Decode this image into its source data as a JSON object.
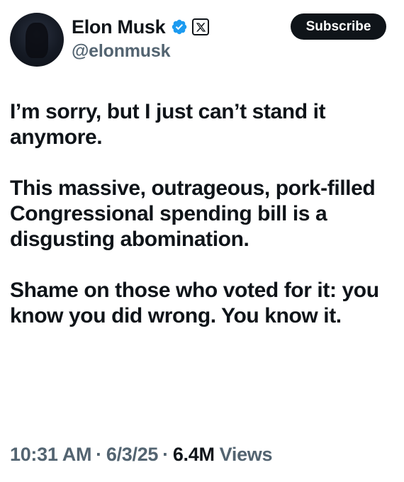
{
  "author": {
    "name": "Elon Musk",
    "handle": "@elonmusk",
    "verified_icon": "verified-badge-icon",
    "affiliate_icon": "x-logo-icon"
  },
  "actions": {
    "subscribe_label": "Subscribe"
  },
  "tweet": {
    "paragraphs": [
      "I’m sorry, but I just can’t stand it anymore.",
      "This massive, outrageous, pork-filled Congressional spending bill is a disgusting abomination.",
      "Shame on those who voted for it: you know you did wrong. You know it."
    ]
  },
  "meta": {
    "time": "10:31 AM",
    "separator": "·",
    "date": "6/3/25",
    "views_count": "6.4M",
    "views_label": "Views"
  },
  "colors": {
    "text": "#0f1419",
    "secondary": "#536471",
    "verified": "#1d9bf0"
  }
}
